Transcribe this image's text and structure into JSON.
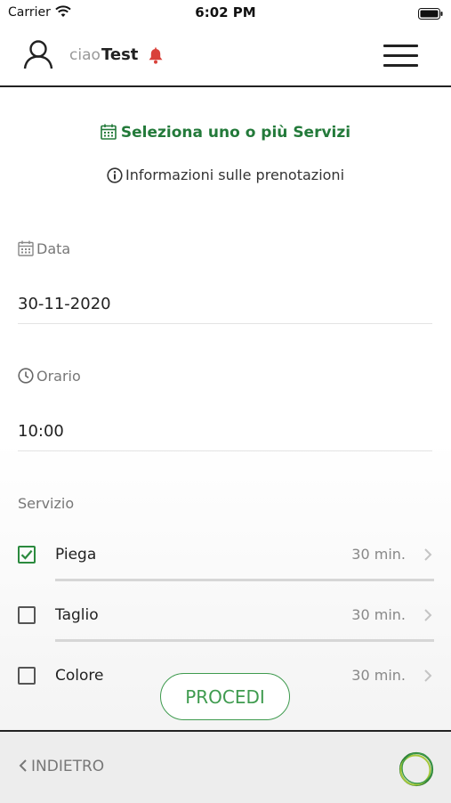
{
  "status_bar": {
    "carrier": "Carrier",
    "time": "6:02 PM"
  },
  "header": {
    "greeting": "ciao",
    "username": "Test"
  },
  "page": {
    "title": "Seleziona uno o più Servizi",
    "info_link": "Informazioni sulle prenotazioni"
  },
  "date_field": {
    "label": "Data",
    "value": "30-11-2020"
  },
  "time_field": {
    "label": "Orario",
    "value": "10:00"
  },
  "services": {
    "label": "Servizio",
    "items": [
      {
        "name": "Piega",
        "duration": "30 min.",
        "checked": true
      },
      {
        "name": "Taglio",
        "duration": "30 min.",
        "checked": false
      },
      {
        "name": "Colore",
        "duration": "30 min.",
        "checked": false
      }
    ]
  },
  "actions": {
    "proceed_label": "PROCEDI",
    "back_label": "INDIETRO"
  },
  "colors": {
    "accent_green": "#237a3a",
    "button_green": "#3f9b4f",
    "bell_red": "#d9413a"
  }
}
